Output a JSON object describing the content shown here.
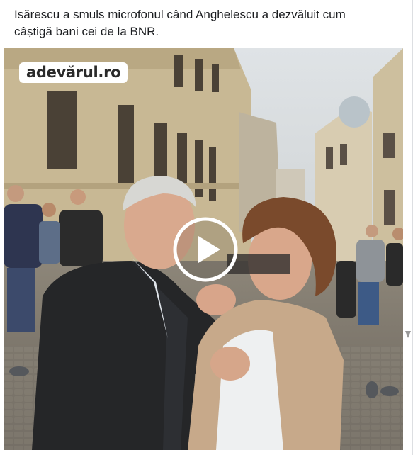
{
  "post": {
    "caption": "Isărescu a smuls microfonul când Anghelescu a dezvăluit cum\ncâștigă bani cei de la BNR."
  },
  "video": {
    "watermark": "adevărul.ro",
    "play_icon": "play-icon"
  },
  "colors": {
    "caption_text": "#1c1e21",
    "border": "#dddfe2",
    "play_overlay": "rgba(255,255,255,0.92)"
  }
}
